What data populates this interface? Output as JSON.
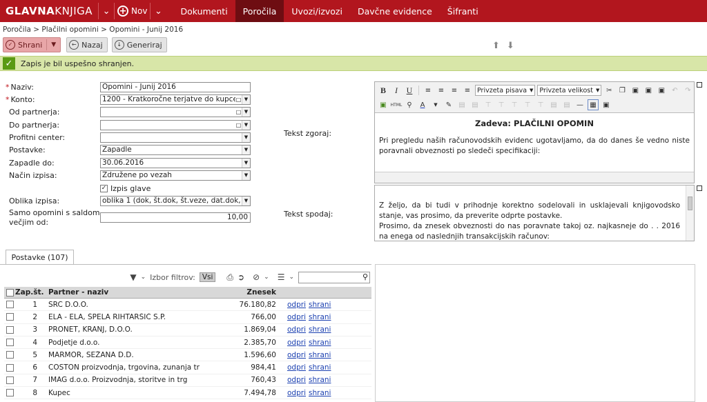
{
  "topbar": {
    "logo_bold": "GLAVNA",
    "logo_thin": "KNJIGA",
    "new_label": "Nov",
    "nav": [
      "Dokumenti",
      "Poročila",
      "Uvozi/izvozi",
      "Davčne evidence",
      "Šifranti"
    ],
    "active_nav": "Poročila"
  },
  "breadcrumb": "Poročila > Plačilni opomini > Opomini - Junij 2016",
  "toolbar": {
    "save_label": "Shrani",
    "back_label": "Nazaj",
    "generate_label": "Generiraj"
  },
  "message": "Zapis je bil uspešno shranjen.",
  "form": {
    "naziv_label": "Naziv:",
    "naziv_value": "Opomini - Junij 2016",
    "konto_label": "Konto:",
    "konto_value": "1200 - Kratkoročne terjatve do kupcev",
    "od_partnerja_label": "Od partnerja:",
    "od_partnerja_value": "",
    "do_partnerja_label": "Do partnerja:",
    "do_partnerja_value": "",
    "profitni_center_label": "Profitni center:",
    "profitni_center_value": "",
    "postavke_label": "Postavke:",
    "postavke_value": "Zapadle",
    "zapadle_do_label": "Zapadle do:",
    "zapadle_do_value": "30.06.2016",
    "nacin_izpisa_label": "Način izpisa:",
    "nacin_izpisa_value": "Združene po vezah",
    "izpis_glave_label": "Izpis glave",
    "oblika_izpisa_label": "Oblika izpisa:",
    "oblika_izpisa_value": "oblika 1 (dok, št.dok, št.veze, dat.dok, d",
    "samo_opomini_label_1": "Samo opomini s saldom",
    "samo_opomini_label_2": "večjim od:",
    "samo_opomini_value": "10,00",
    "tekst_zgoraj_label": "Tekst zgoraj:",
    "tekst_spodaj_label": "Tekst spodaj:"
  },
  "editor": {
    "font_family_select": "Privzeta pisava",
    "font_size_select": "Privzeta velikost",
    "html_label": "HTML",
    "top_heading": "Zadeva: PLAČILNI OPOMIN",
    "top_text": "Pri pregledu naših računovodskih evidenc ugotavljamo, da do danes še vedno niste poravnali obveznosti po sledeči specifikaciji:",
    "bottom_text_1": "Z željo, da bi tudi v prihodnje korektno sodelovali in usklajevali knjigovodsko stanje, vas prosimo, da preverite odprte postavke.",
    "bottom_text_2": "Prosimo, da znesek obveznosti do nas poravnate takoj oz. najkasneje do . . 2016 na enega od naslednjih transakcijskih računov:"
  },
  "grid": {
    "tab_label": "Postavke (107)",
    "filter_label": "Izbor filtrov:",
    "filter_value": "Vsi",
    "col_no": "Zap.št.",
    "col_name": "Partner - naziv",
    "col_amount": "Znesek",
    "open_label": "odpri",
    "save_label": "shrani",
    "rows": [
      {
        "no": "1",
        "name": "SRC D.O.O.",
        "amount": "76.180,82"
      },
      {
        "no": "2",
        "name": "ELA - ELA, ŠPELA RIHTARŠIČ S.P.",
        "amount": "766,00"
      },
      {
        "no": "3",
        "name": "PRONET, KRANJ, D.O.O.",
        "amount": "1.869,04"
      },
      {
        "no": "4",
        "name": "Podjetje d.o.o.",
        "amount": "2.385,70"
      },
      {
        "no": "5",
        "name": "MARMOR, SEŽANA D.D.",
        "amount": "1.596,60"
      },
      {
        "no": "6",
        "name": "COSTON proizvodnja, trgovina, zunanja tr",
        "amount": "984,41"
      },
      {
        "no": "7",
        "name": "IMAG d.o.o. Proizvodnja, storitve in trg",
        "amount": "760,43"
      },
      {
        "no": "8",
        "name": "Kupec",
        "amount": "7.494,78"
      }
    ]
  }
}
